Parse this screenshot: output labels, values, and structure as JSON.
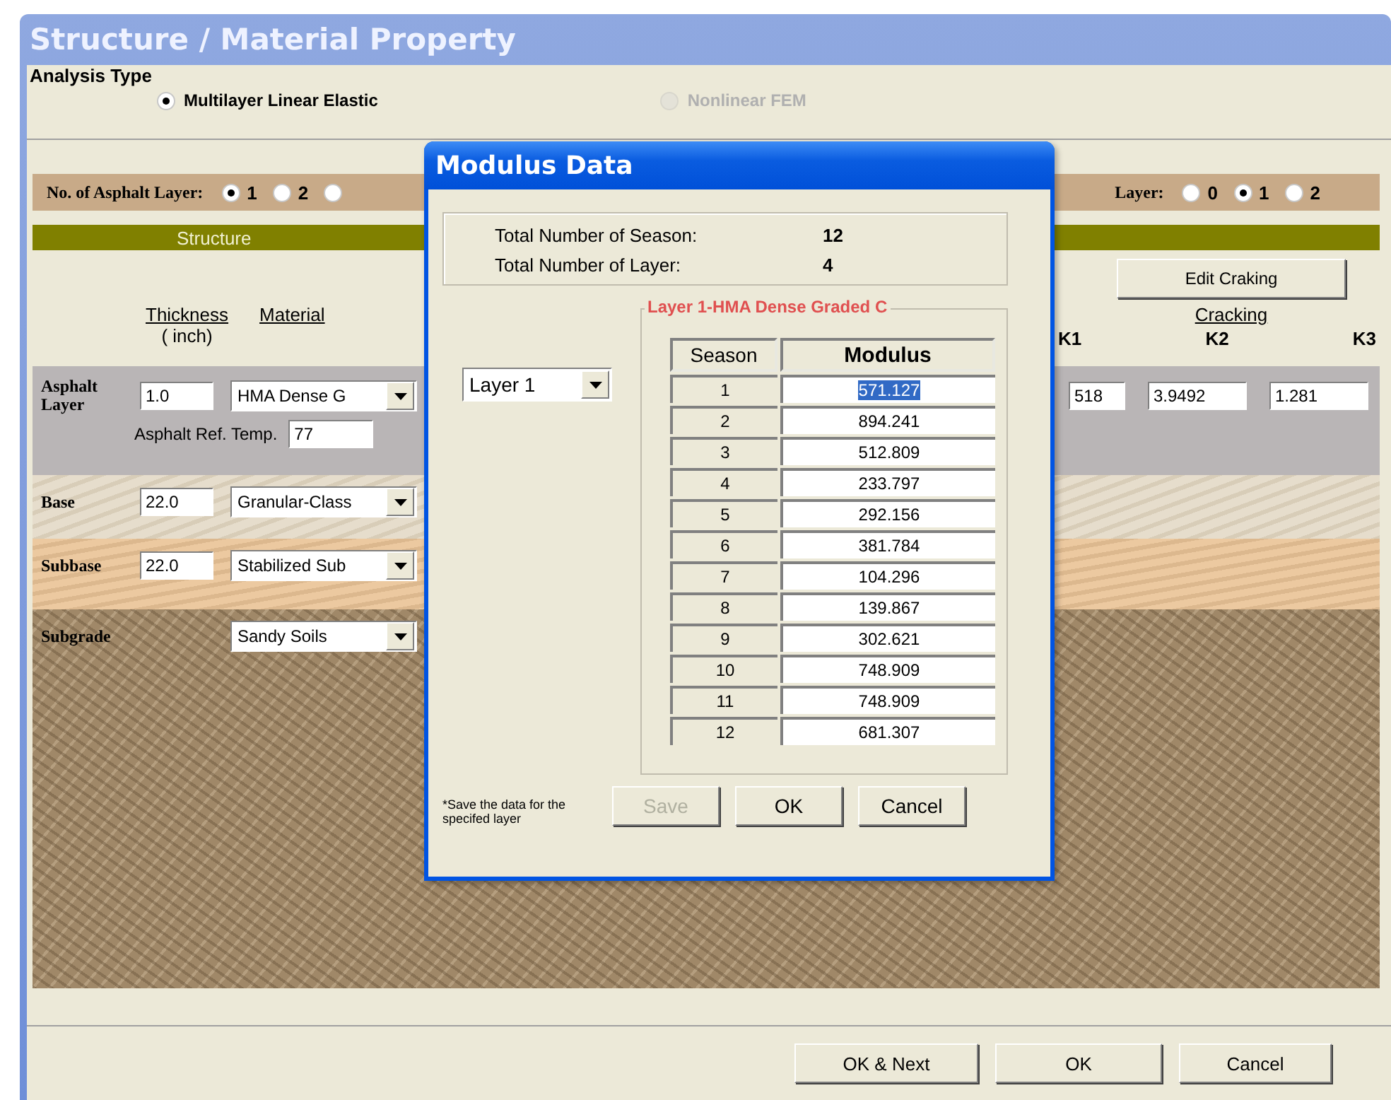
{
  "window": {
    "title": "Structure / Material Property"
  },
  "analysis_type": {
    "label": "Analysis Type",
    "options": [
      {
        "label": "Multilayer Linear Elastic",
        "selected": true,
        "disabled": false
      },
      {
        "label": "Nonlinear FEM",
        "selected": false,
        "disabled": true
      }
    ]
  },
  "asphalt_layer_count": {
    "label": "No. of Asphalt Layer:",
    "options": [
      {
        "label": "1",
        "selected": true
      },
      {
        "label": "2",
        "selected": false
      },
      {
        "selected": false
      }
    ]
  },
  "other_layer_count": {
    "label": "Layer:",
    "options": [
      {
        "label": "0",
        "selected": false
      },
      {
        "label": "1",
        "selected": true
      },
      {
        "label": "2",
        "selected": false
      }
    ]
  },
  "structure_bar": {
    "label": "Structure"
  },
  "headers": {
    "thickness": "Thickness",
    "unit": "( inch)",
    "material": "Material"
  },
  "layers": [
    {
      "kind": "asphalt",
      "name": "Asphalt Layer",
      "thickness": "1.0",
      "material": "HMA Dense G",
      "ref_temp_label": "Asphalt Ref. Temp.",
      "ref_temp": "77"
    },
    {
      "kind": "base",
      "name": "Base",
      "thickness": "22.0",
      "material": "Granular-Class"
    },
    {
      "kind": "subbase",
      "name": "Subbase",
      "thickness": "22.0",
      "material": "Stabilized Sub"
    },
    {
      "kind": "subgrade",
      "name": "Subgrade",
      "material": "Sandy Soils"
    }
  ],
  "cracking": {
    "button": "Edit Craking",
    "title": "Cracking",
    "columns": [
      "K1",
      "K2",
      "K3"
    ],
    "values": [
      "518",
      "3.9492",
      "1.281"
    ]
  },
  "buttons": [
    "OK & Next",
    "OK",
    "Cancel"
  ],
  "dialog": {
    "title": "Modulus Data",
    "totals": [
      {
        "label": "Total Number of Season:",
        "value": "12"
      },
      {
        "label": "Total Number of Layer:",
        "value": "4"
      }
    ],
    "layer_select": "Layer 1",
    "group_title": "Layer 1-HMA Dense Graded C",
    "columns": [
      "Season",
      "Modulus"
    ],
    "rows": [
      {
        "season": "1",
        "modulus": "571.127",
        "selected": true
      },
      {
        "season": "2",
        "modulus": "894.241",
        "selected": false
      },
      {
        "season": "3",
        "modulus": "512.809",
        "selected": false
      },
      {
        "season": "4",
        "modulus": "233.797",
        "selected": false
      },
      {
        "season": "5",
        "modulus": "292.156",
        "selected": false
      },
      {
        "season": "6",
        "modulus": "381.784",
        "selected": false
      },
      {
        "season": "7",
        "modulus": "104.296",
        "selected": false
      },
      {
        "season": "8",
        "modulus": "139.867",
        "selected": false
      },
      {
        "season": "9",
        "modulus": "302.621",
        "selected": false
      },
      {
        "season": "10",
        "modulus": "748.909",
        "selected": false
      },
      {
        "season": "11",
        "modulus": "748.909",
        "selected": false
      },
      {
        "season": "12",
        "modulus": "681.307",
        "selected": false
      }
    ],
    "note": "*Save the data for the specifed layer",
    "buttons": [
      {
        "label": "Save",
        "disabled": true
      },
      {
        "label": "OK",
        "disabled": false
      },
      {
        "label": "Cancel",
        "disabled": false
      }
    ]
  }
}
